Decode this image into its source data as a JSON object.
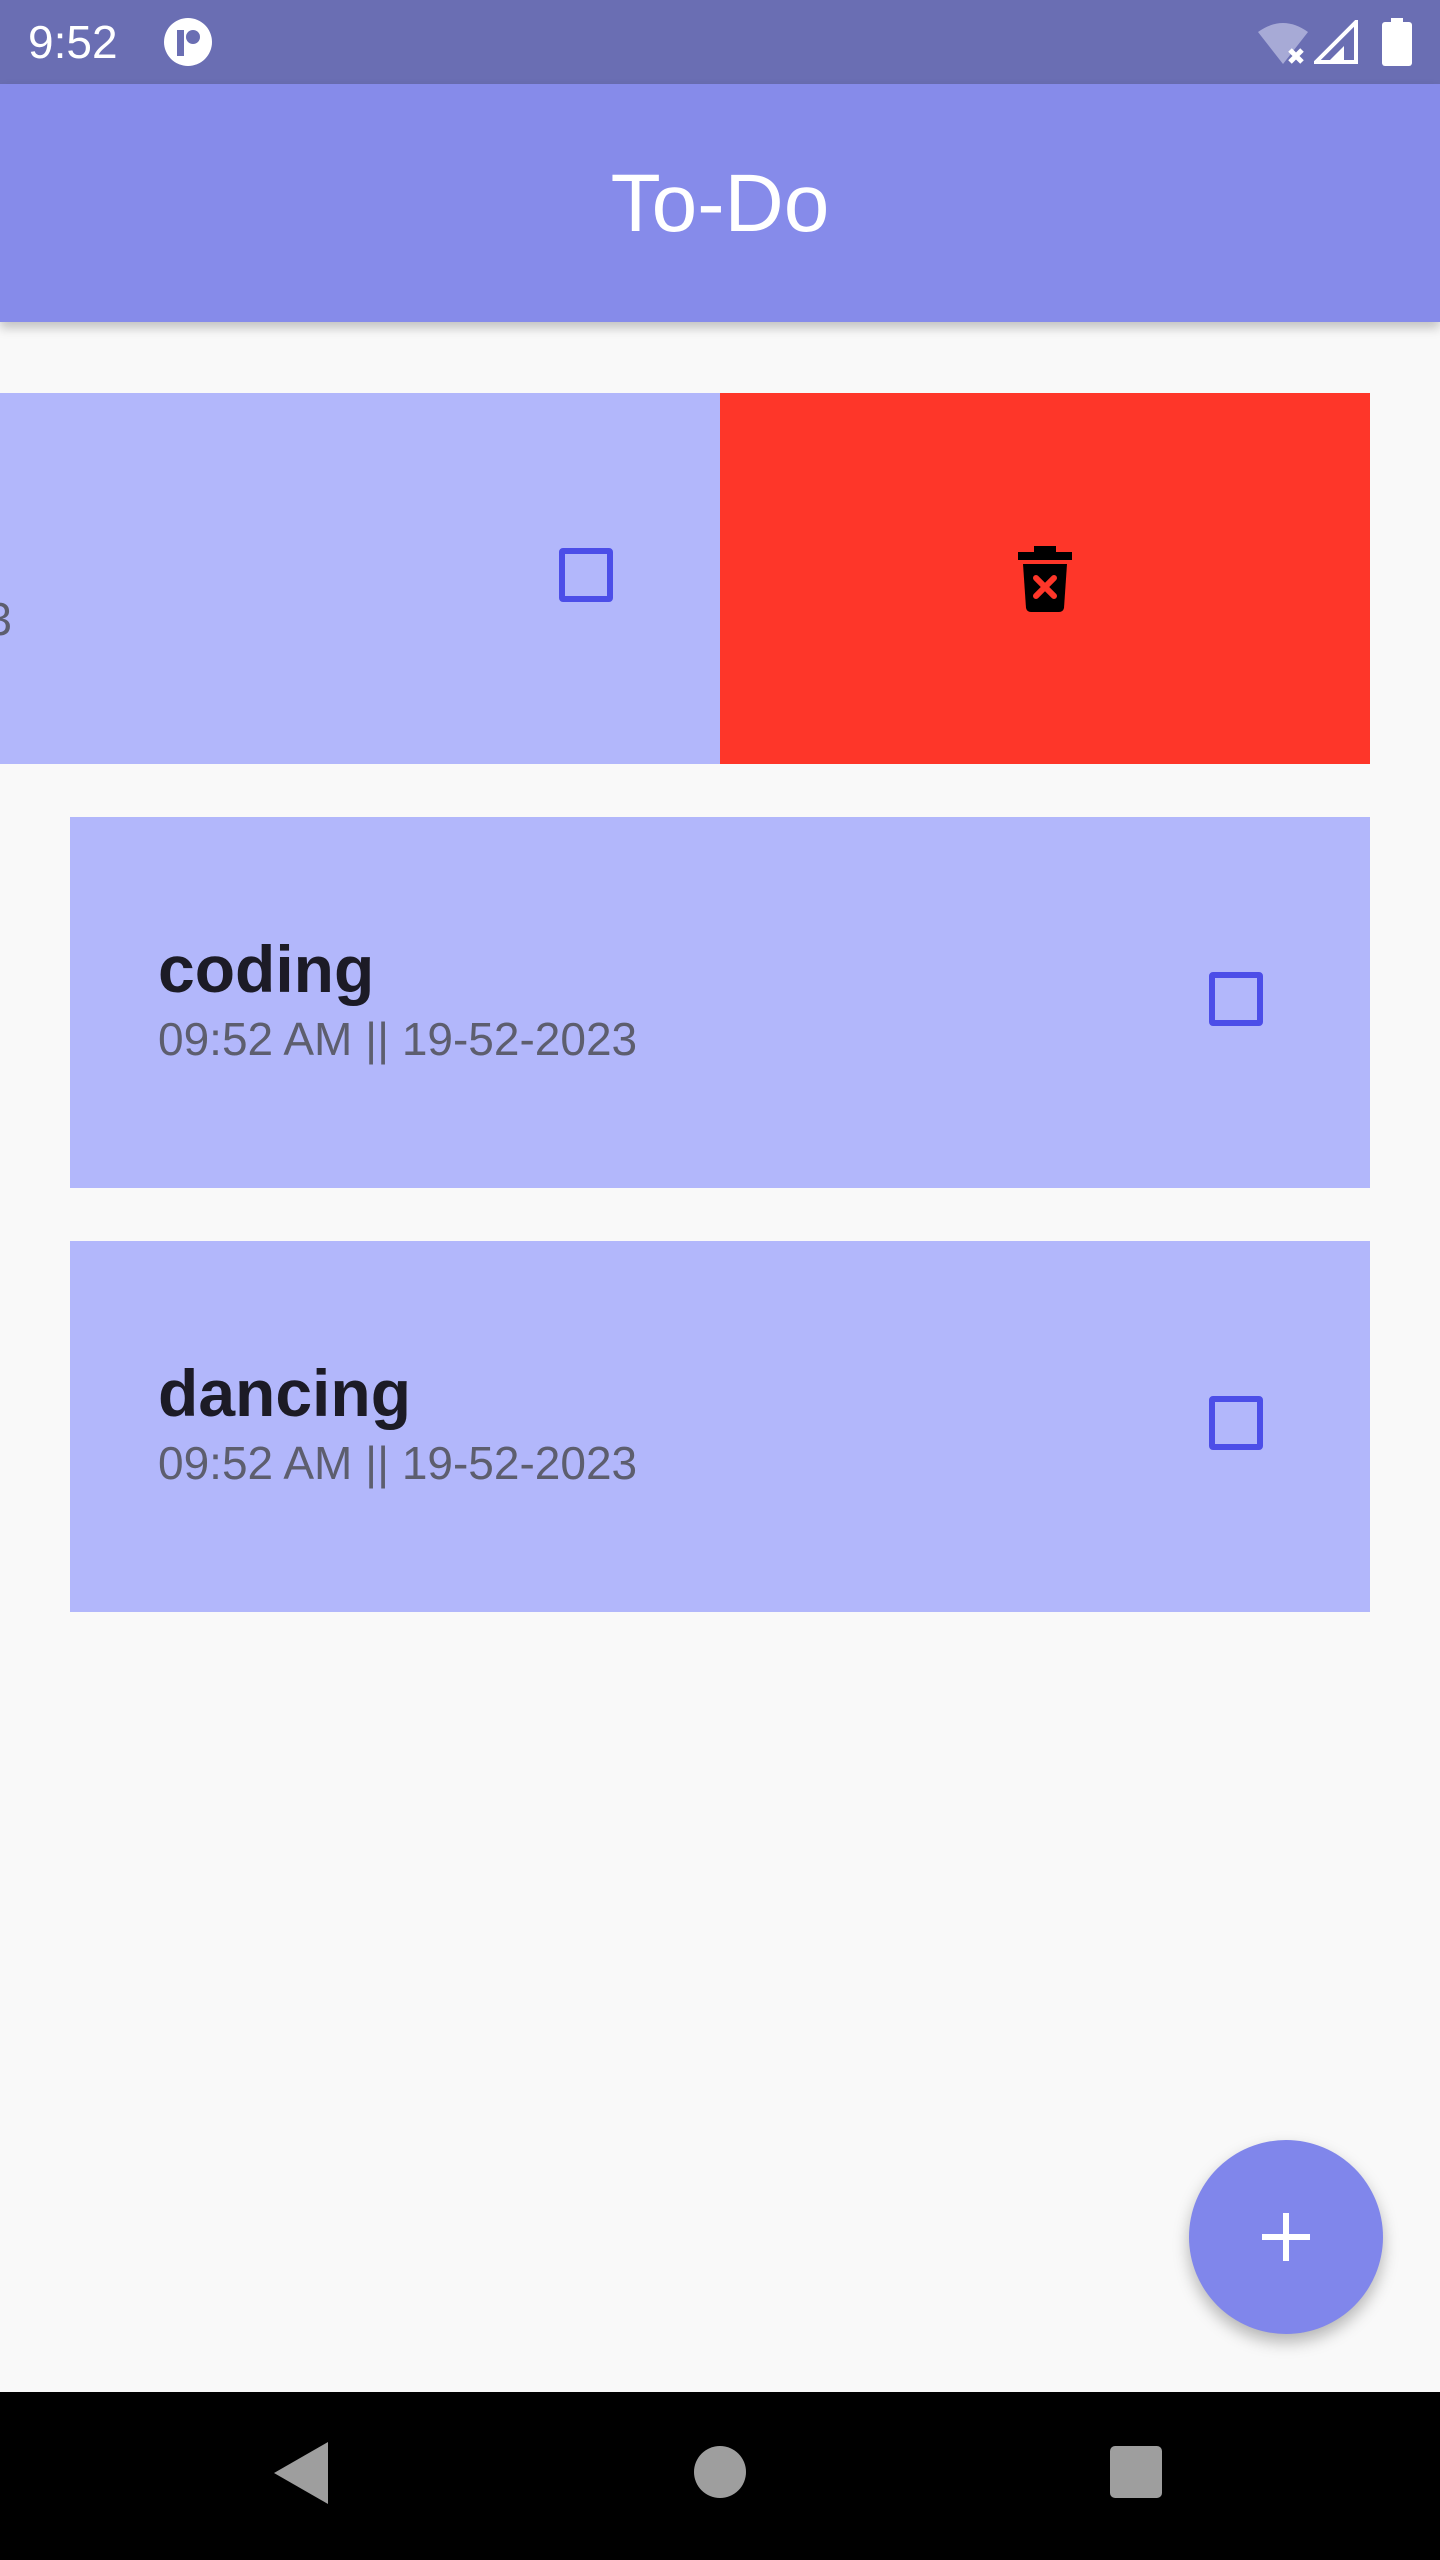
{
  "status_bar": {
    "time": "9:52",
    "icons": [
      "app-notification-icon",
      "wifi-off-icon",
      "cell-signal-icon",
      "battery-icon"
    ]
  },
  "app_bar": {
    "title": "To-Do",
    "color": "#868bea"
  },
  "swiped_task": {
    "date_fragment": "3",
    "checked": false,
    "delete_color": "#fe3629",
    "delete_icon": "delete-forever-icon"
  },
  "tasks": [
    {
      "title": "coding",
      "date": "09:52 AM || 19-52-2023",
      "checked": false
    },
    {
      "title": "dancing",
      "date": "09:52 AM || 19-52-2023",
      "checked": false
    }
  ],
  "fab": {
    "icon": "plus-icon",
    "color": "#8086eb"
  },
  "nav_bar": {
    "icons": [
      "back-icon",
      "home-icon",
      "recents-icon"
    ]
  },
  "colors": {
    "card": "#b2b7fb",
    "checkbox": "#4c4ee8",
    "background": "#f9f9f9"
  }
}
